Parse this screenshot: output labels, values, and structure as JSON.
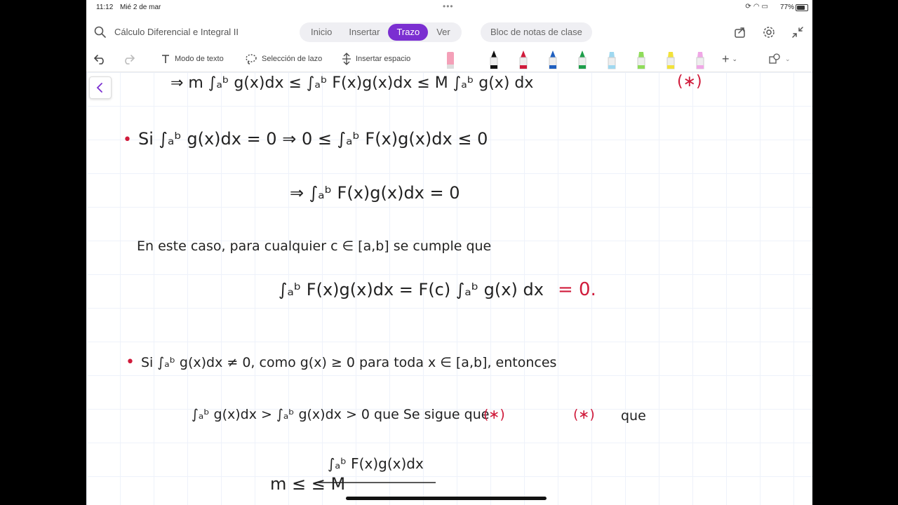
{
  "status_bar": {
    "time": "11:12",
    "date": "Mié 2 de mar",
    "battery": "77%"
  },
  "header": {
    "notebook_title": "Cálculo Diferencial e Integral II",
    "tabs": [
      {
        "label": "Inicio",
        "active": false
      },
      {
        "label": "Insertar",
        "active": false
      },
      {
        "label": "Trazo",
        "active": true
      },
      {
        "label": "Ver",
        "active": false
      }
    ],
    "bloc_label": "Bloc de notas de clase",
    "accent": "#7b2fd1"
  },
  "toolbar": {
    "text_mode": "Modo de texto",
    "lasso": "Selección de lazo",
    "insert_space": "Insertar espacio",
    "pens": [
      {
        "color": "#f4a0b8",
        "type": "eraser"
      },
      {
        "color": "#111111",
        "type": "pen"
      },
      {
        "color": "#d01b3b",
        "type": "pen"
      },
      {
        "color": "#1f5fbf",
        "type": "pen"
      },
      {
        "color": "#1e9e4a",
        "type": "pen"
      },
      {
        "color": "#9fd8f0",
        "type": "highlighter"
      },
      {
        "color": "#8fdc5a",
        "type": "highlighter"
      },
      {
        "color": "#f2e23a",
        "type": "highlighter"
      },
      {
        "color": "#f0a7e6",
        "type": "highlighter"
      }
    ]
  },
  "notes": {
    "line1": "⇒       m ∫ₐᵇ g(x)dx ≤ ∫ₐᵇ F(x)g(x)dx ≤ M ∫ₐᵇ g(x) dx",
    "line1_mark": "(∗)",
    "line2_bullet": "•",
    "line2": "Si  ∫ₐᵇ g(x)dx = 0  ⇒  0 ≤ ∫ₐᵇ F(x)g(x)dx ≤ 0",
    "line3": "⇒  ∫ₐᵇ F(x)g(x)dx = 0",
    "line4": "En  este  caso,  para  cualquier  c ∈ [a,b]  se  cumple  que",
    "line5": "∫ₐᵇ F(x)g(x)dx  =  F(c) ∫ₐᵇ g(x) dx",
    "line5_result": "= 0.",
    "line6_bullet": "•",
    "line6": "Si  ∫ₐᵇ g(x)dx ≠ 0,    como  g(x) ≥ 0  para  toda  x ∈ [a,b],  entonces",
    "line7": "∫ₐᵇ g(x)dx > ∫ₐᵇ g(x)dx > 0   que   Se   sigue   que",
    "line7_mark1": "(∗)",
    "line7_mark2": "(∗)",
    "line7_tail": "que",
    "line8_num": "∫ₐᵇ F(x)g(x)dx",
    "line8": "m ≤                      ≤ M"
  }
}
